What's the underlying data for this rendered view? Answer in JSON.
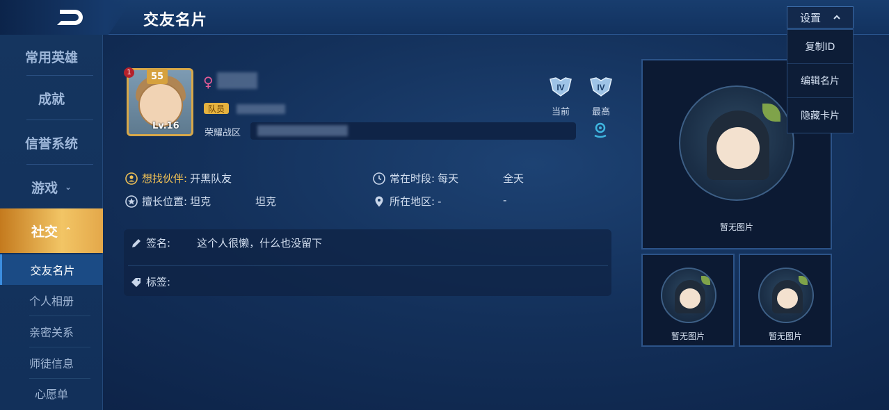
{
  "header": {
    "title": "交友名片",
    "settings_label": "设置",
    "settings_menu": [
      "复制ID",
      "编辑名片",
      "隐藏卡片"
    ]
  },
  "sidebar": {
    "items": [
      {
        "label": "常用英雄"
      },
      {
        "label": "成就"
      },
      {
        "label": "信誉系统"
      },
      {
        "label": "游戏"
      },
      {
        "label": "社交"
      }
    ],
    "sub_items": [
      {
        "label": "交友名片"
      },
      {
        "label": "个人相册"
      },
      {
        "label": "亲密关系"
      },
      {
        "label": "师徒信息"
      },
      {
        "label": "心愿单"
      }
    ]
  },
  "profile": {
    "avatar_level": "55",
    "avatar_rank_badge": "1",
    "avatar_lv": "Lv.16",
    "member_tag": "队员",
    "zone_label": "荣耀战区",
    "rank_current_label": "当前",
    "rank_highest_label": "最高",
    "rank_current_tier": "IV",
    "rank_highest_tier": "IV"
  },
  "info": {
    "partner_key": "想找伙伴:",
    "partner_val": "开黑队友",
    "position_key": "擅长位置:",
    "position_val1": "坦克",
    "position_val2": "坦克",
    "time_key": "常在时段:",
    "time_val1": "每天",
    "time_val2": "全天",
    "region_key": "所在地区:",
    "region_val1": "-",
    "region_val2": "-"
  },
  "signature": {
    "sign_key": "签名:",
    "sign_val": "这个人很懒，什么也没留下",
    "tags_key": "标签:"
  },
  "photos": {
    "empty_caption": "暂无图片"
  },
  "colors": {
    "accent_gold": "#f0c155",
    "active_tab": "#e4a84a",
    "location_cyan": "#3fb6e0"
  }
}
